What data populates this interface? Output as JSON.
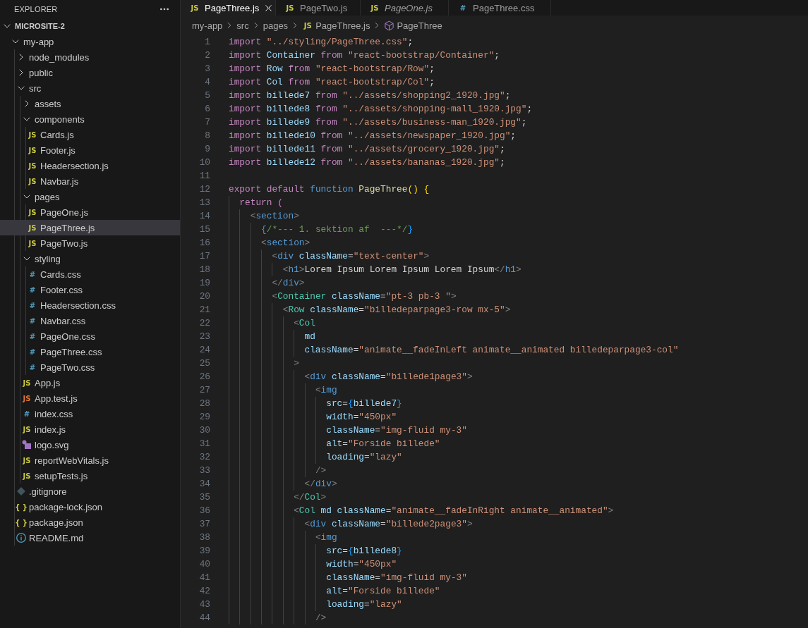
{
  "explorer": {
    "title": "EXPLORER",
    "tree": [
      {
        "label": "MICROSITE-2",
        "kind": "root",
        "expanded": true,
        "selected": false,
        "children": [
          {
            "label": "my-app",
            "kind": "folder",
            "expanded": true,
            "selected": false,
            "children": [
              {
                "label": "node_modules",
                "kind": "folder",
                "expanded": false,
                "selected": false
              },
              {
                "label": "public",
                "kind": "folder",
                "expanded": false,
                "selected": false
              },
              {
                "label": "src",
                "kind": "folder",
                "expanded": true,
                "selected": false,
                "children": [
                  {
                    "label": "assets",
                    "kind": "folder",
                    "expanded": false,
                    "selected": false
                  },
                  {
                    "label": "components",
                    "kind": "folder",
                    "expanded": true,
                    "selected": false,
                    "children": [
                      {
                        "label": "Cards.js",
                        "kind": "js",
                        "icon": "JS",
                        "selected": false
                      },
                      {
                        "label": "Footer.js",
                        "kind": "js",
                        "icon": "JS",
                        "selected": false
                      },
                      {
                        "label": "Headersection.js",
                        "kind": "js",
                        "icon": "JS",
                        "selected": false
                      },
                      {
                        "label": "Navbar.js",
                        "kind": "js",
                        "icon": "JS",
                        "selected": false
                      }
                    ]
                  },
                  {
                    "label": "pages",
                    "kind": "folder",
                    "expanded": true,
                    "selected": false,
                    "children": [
                      {
                        "label": "PageOne.js",
                        "kind": "js",
                        "icon": "JS",
                        "selected": false
                      },
                      {
                        "label": "PageThree.js",
                        "kind": "js",
                        "icon": "JS",
                        "selected": true
                      },
                      {
                        "label": "PageTwo.js",
                        "kind": "js",
                        "icon": "JS",
                        "selected": false
                      }
                    ]
                  },
                  {
                    "label": "styling",
                    "kind": "folder",
                    "expanded": true,
                    "selected": false,
                    "children": [
                      {
                        "label": "Cards.css",
                        "kind": "css",
                        "icon": "#",
                        "selected": false
                      },
                      {
                        "label": "Footer.css",
                        "kind": "css",
                        "icon": "#",
                        "selected": false
                      },
                      {
                        "label": "Headersection.css",
                        "kind": "css",
                        "icon": "#",
                        "selected": false
                      },
                      {
                        "label": "Navbar.css",
                        "kind": "css",
                        "icon": "#",
                        "selected": false
                      },
                      {
                        "label": "PageOne.css",
                        "kind": "css",
                        "icon": "#",
                        "selected": false
                      },
                      {
                        "label": "PageThree.css",
                        "kind": "css",
                        "icon": "#",
                        "selected": false
                      },
                      {
                        "label": "PageTwo.css",
                        "kind": "css",
                        "icon": "#",
                        "selected": false
                      }
                    ]
                  },
                  {
                    "label": "App.js",
                    "kind": "js",
                    "icon": "JS",
                    "selected": false
                  },
                  {
                    "label": "App.test.js",
                    "kind": "test",
                    "icon": "JS",
                    "selected": false
                  },
                  {
                    "label": "index.css",
                    "kind": "css",
                    "icon": "#",
                    "selected": false
                  },
                  {
                    "label": "index.js",
                    "kind": "js",
                    "icon": "JS",
                    "selected": false
                  },
                  {
                    "label": "logo.svg",
                    "kind": "svg",
                    "selected": false
                  },
                  {
                    "label": "reportWebVitals.js",
                    "kind": "js",
                    "icon": "JS",
                    "selected": false
                  },
                  {
                    "label": "setupTests.js",
                    "kind": "js",
                    "icon": "JS",
                    "selected": false
                  }
                ]
              },
              {
                "label": ".gitignore",
                "kind": "git",
                "selected": false
              },
              {
                "label": "package-lock.json",
                "kind": "json",
                "icon": "{ }",
                "selected": false
              },
              {
                "label": "package.json",
                "kind": "json",
                "icon": "{ }",
                "selected": false
              },
              {
                "label": "README.md",
                "kind": "info",
                "selected": false
              }
            ]
          }
        ]
      }
    ]
  },
  "tabs": [
    {
      "label": "PageThree.js",
      "kind": "js",
      "icon": "JS",
      "selected": true,
      "preview": false
    },
    {
      "label": "PageTwo.js",
      "kind": "js",
      "icon": "JS",
      "selected": false,
      "preview": false
    },
    {
      "label": "PageOne.js",
      "kind": "js",
      "icon": "JS",
      "selected": false,
      "preview": true
    },
    {
      "label": "PageThree.css",
      "kind": "css",
      "icon": "#",
      "selected": false,
      "preview": false
    }
  ],
  "breadcrumbs": [
    {
      "kind": "folder",
      "text": "my-app"
    },
    {
      "kind": "folder",
      "text": "src"
    },
    {
      "kind": "folder",
      "text": "pages"
    },
    {
      "kind": "file",
      "icon": "JS",
      "text": "PageThree.js"
    },
    {
      "kind": "symbol",
      "text": "PageThree"
    }
  ],
  "code": [
    {
      "number": "1",
      "tokens": [
        {
          "kind": "kw",
          "text": "import "
        },
        {
          "kind": "str",
          "text": "\"../styling/PageThree.css\""
        },
        {
          "kind": "plain",
          "text": ";"
        }
      ]
    },
    {
      "number": "2",
      "tokens": [
        {
          "kind": "kw",
          "text": "import "
        },
        {
          "kind": "var",
          "text": "Container "
        },
        {
          "kind": "kw",
          "text": "from "
        },
        {
          "kind": "str",
          "text": "\"react-bootstrap/Container\""
        },
        {
          "kind": "plain",
          "text": ";"
        }
      ]
    },
    {
      "number": "3",
      "tokens": [
        {
          "kind": "kw",
          "text": "import "
        },
        {
          "kind": "var",
          "text": "Row "
        },
        {
          "kind": "kw",
          "text": "from "
        },
        {
          "kind": "str",
          "text": "\"react-bootstrap/Row\""
        },
        {
          "kind": "plain",
          "text": ";"
        }
      ]
    },
    {
      "number": "4",
      "tokens": [
        {
          "kind": "kw",
          "text": "import "
        },
        {
          "kind": "var",
          "text": "Col "
        },
        {
          "kind": "kw",
          "text": "from "
        },
        {
          "kind": "str",
          "text": "\"react-bootstrap/Col\""
        },
        {
          "kind": "plain",
          "text": ";"
        }
      ]
    },
    {
      "number": "5",
      "tokens": [
        {
          "kind": "kw",
          "text": "import "
        },
        {
          "kind": "var",
          "text": "billede7 "
        },
        {
          "kind": "kw",
          "text": "from "
        },
        {
          "kind": "str",
          "text": "\"../assets/shopping2_1920.jpg\""
        },
        {
          "kind": "plain",
          "text": ";"
        }
      ]
    },
    {
      "number": "6",
      "tokens": [
        {
          "kind": "kw",
          "text": "import "
        },
        {
          "kind": "var",
          "text": "billede8 "
        },
        {
          "kind": "kw",
          "text": "from "
        },
        {
          "kind": "str",
          "text": "\"../assets/shopping-mall_1920.jpg\""
        },
        {
          "kind": "plain",
          "text": ";"
        }
      ]
    },
    {
      "number": "7",
      "tokens": [
        {
          "kind": "kw",
          "text": "import "
        },
        {
          "kind": "var",
          "text": "billede9 "
        },
        {
          "kind": "kw",
          "text": "from "
        },
        {
          "kind": "str",
          "text": "\"../assets/business-man_1920.jpg\""
        },
        {
          "kind": "plain",
          "text": ";"
        }
      ]
    },
    {
      "number": "8",
      "tokens": [
        {
          "kind": "kw",
          "text": "import "
        },
        {
          "kind": "var",
          "text": "billede10 "
        },
        {
          "kind": "kw",
          "text": "from "
        },
        {
          "kind": "str",
          "text": "\"../assets/newspaper_1920.jpg\""
        },
        {
          "kind": "plain",
          "text": ";"
        }
      ]
    },
    {
      "number": "9",
      "tokens": [
        {
          "kind": "kw",
          "text": "import "
        },
        {
          "kind": "var",
          "text": "billede11 "
        },
        {
          "kind": "kw",
          "text": "from "
        },
        {
          "kind": "str",
          "text": "\"../assets/grocery_1920.jpg\""
        },
        {
          "kind": "plain",
          "text": ";"
        }
      ]
    },
    {
      "number": "10",
      "tokens": [
        {
          "kind": "kw",
          "text": "import "
        },
        {
          "kind": "var",
          "text": "billede12 "
        },
        {
          "kind": "kw",
          "text": "from "
        },
        {
          "kind": "str",
          "text": "\"../assets/bananas_1920.jpg\""
        },
        {
          "kind": "plain",
          "text": ";"
        }
      ]
    },
    {
      "number": "11"
    },
    {
      "number": "12",
      "tokens": [
        {
          "kind": "kw",
          "text": "export default "
        },
        {
          "kind": "kw2",
          "text": "function "
        },
        {
          "kind": "fn",
          "text": "PageThree"
        },
        {
          "kind": "br1",
          "text": "() {"
        }
      ],
      "children": [
        {
          "number": "13",
          "tokens": [
            {
              "kind": "kw",
              "text": "return "
            },
            {
              "kind": "br2",
              "text": "("
            }
          ],
          "children": [
            {
              "number": "14",
              "tokens": [
                {
                  "kind": "lt",
                  "text": "<"
                },
                {
                  "kind": "tag",
                  "text": "section"
                },
                {
                  "kind": "lt",
                  "text": ">"
                }
              ],
              "children": [
                {
                  "number": "15",
                  "tokens": [
                    {
                      "kind": "br3",
                      "text": "{"
                    },
                    {
                      "kind": "cmt",
                      "text": "/*--- 1. sektion af  ---*/"
                    },
                    {
                      "kind": "br3",
                      "text": "}"
                    }
                  ]
                },
                {
                  "number": "16",
                  "tokens": [
                    {
                      "kind": "lt",
                      "text": "<"
                    },
                    {
                      "kind": "tag",
                      "text": "section"
                    },
                    {
                      "kind": "lt",
                      "text": ">"
                    }
                  ],
                  "children": [
                    {
                      "number": "17",
                      "tokens": [
                        {
                          "kind": "lt",
                          "text": "<"
                        },
                        {
                          "kind": "tag",
                          "text": "div"
                        },
                        {
                          "kind": "attr",
                          "text": " className"
                        },
                        {
                          "kind": "plain",
                          "text": "="
                        },
                        {
                          "kind": "str",
                          "text": "\"text-center\""
                        },
                        {
                          "kind": "lt",
                          "text": ">"
                        }
                      ],
                      "children": [
                        {
                          "number": "18",
                          "tokens": [
                            {
                              "kind": "lt",
                              "text": "<"
                            },
                            {
                              "kind": "tag",
                              "text": "h1"
                            },
                            {
                              "kind": "lt",
                              "text": ">"
                            },
                            {
                              "kind": "plain",
                              "text": "Lorem Ipsum Lorem Ipsum Lorem Ipsum"
                            },
                            {
                              "kind": "lt",
                              "text": "</"
                            },
                            {
                              "kind": "tag",
                              "text": "h1"
                            },
                            {
                              "kind": "lt",
                              "text": ">"
                            }
                          ]
                        }
                      ]
                    },
                    {
                      "number": "19",
                      "tokens": [
                        {
                          "kind": "lt",
                          "text": "</"
                        },
                        {
                          "kind": "tag",
                          "text": "div"
                        },
                        {
                          "kind": "lt",
                          "text": ">"
                        }
                      ]
                    },
                    {
                      "number": "20",
                      "tokens": [
                        {
                          "kind": "lt",
                          "text": "<"
                        },
                        {
                          "kind": "comp",
                          "text": "Container"
                        },
                        {
                          "kind": "attr",
                          "text": " className"
                        },
                        {
                          "kind": "plain",
                          "text": "="
                        },
                        {
                          "kind": "str",
                          "text": "\"pt-3 pb-3 \""
                        },
                        {
                          "kind": "lt",
                          "text": ">"
                        }
                      ],
                      "children": [
                        {
                          "number": "21",
                          "tokens": [
                            {
                              "kind": "lt",
                              "text": "<"
                            },
                            {
                              "kind": "comp",
                              "text": "Row"
                            },
                            {
                              "kind": "attr",
                              "text": " className"
                            },
                            {
                              "kind": "plain",
                              "text": "="
                            },
                            {
                              "kind": "str",
                              "text": "\"billedeparpage3-row mx-5\""
                            },
                            {
                              "kind": "lt",
                              "text": ">"
                            }
                          ],
                          "children": [
                            {
                              "number": "22",
                              "tokens": [
                                {
                                  "kind": "lt",
                                  "text": "<"
                                },
                                {
                                  "kind": "comp",
                                  "text": "Col"
                                }
                              ],
                              "children": [
                                {
                                  "number": "23",
                                  "tokens": [
                                    {
                                      "kind": "attr",
                                      "text": "md"
                                    }
                                  ]
                                },
                                {
                                  "number": "24",
                                  "tokens": [
                                    {
                                      "kind": "attr",
                                      "text": "className"
                                    },
                                    {
                                      "kind": "plain",
                                      "text": "="
                                    },
                                    {
                                      "kind": "str",
                                      "text": "\"animate__fadeInLeft animate__animated billedeparpage3-col\""
                                    }
                                  ]
                                }
                              ]
                            },
                            {
                              "number": "25",
                              "tokens": [
                                {
                                  "kind": "lt",
                                  "text": ">"
                                }
                              ],
                              "children": [
                                {
                                  "number": "26",
                                  "tokens": [
                                    {
                                      "kind": "lt",
                                      "text": "<"
                                    },
                                    {
                                      "kind": "tag",
                                      "text": "div"
                                    },
                                    {
                                      "kind": "attr",
                                      "text": " className"
                                    },
                                    {
                                      "kind": "plain",
                                      "text": "="
                                    },
                                    {
                                      "kind": "str",
                                      "text": "\"billede1page3\""
                                    },
                                    {
                                      "kind": "lt",
                                      "text": ">"
                                    }
                                  ],
                                  "children": [
                                    {
                                      "number": "27",
                                      "tokens": [
                                        {
                                          "kind": "lt",
                                          "text": "<"
                                        },
                                        {
                                          "kind": "tag",
                                          "text": "img"
                                        }
                                      ],
                                      "children": [
                                        {
                                          "number": "28",
                                          "tokens": [
                                            {
                                              "kind": "attr",
                                              "text": "src"
                                            },
                                            {
                                              "kind": "plain",
                                              "text": "="
                                            },
                                            {
                                              "kind": "br3",
                                              "text": "{"
                                            },
                                            {
                                              "kind": "var",
                                              "text": "billede7"
                                            },
                                            {
                                              "kind": "br3",
                                              "text": "}"
                                            }
                                          ]
                                        },
                                        {
                                          "number": "29",
                                          "tokens": [
                                            {
                                              "kind": "attr",
                                              "text": "width"
                                            },
                                            {
                                              "kind": "plain",
                                              "text": "="
                                            },
                                            {
                                              "kind": "str",
                                              "text": "\"450px\""
                                            }
                                          ]
                                        },
                                        {
                                          "number": "30",
                                          "tokens": [
                                            {
                                              "kind": "attr",
                                              "text": "className"
                                            },
                                            {
                                              "kind": "plain",
                                              "text": "="
                                            },
                                            {
                                              "kind": "str",
                                              "text": "\"img-fluid my-3\""
                                            }
                                          ]
                                        },
                                        {
                                          "number": "31",
                                          "tokens": [
                                            {
                                              "kind": "attr",
                                              "text": "alt"
                                            },
                                            {
                                              "kind": "plain",
                                              "text": "="
                                            },
                                            {
                                              "kind": "str",
                                              "text": "\"Forside billede\""
                                            }
                                          ]
                                        },
                                        {
                                          "number": "32",
                                          "tokens": [
                                            {
                                              "kind": "attr",
                                              "text": "loading"
                                            },
                                            {
                                              "kind": "plain",
                                              "text": "="
                                            },
                                            {
                                              "kind": "str",
                                              "text": "\"lazy\""
                                            }
                                          ]
                                        }
                                      ]
                                    },
                                    {
                                      "number": "33",
                                      "tokens": [
                                        {
                                          "kind": "lt",
                                          "text": "/>"
                                        }
                                      ]
                                    }
                                  ]
                                },
                                {
                                  "number": "34",
                                  "tokens": [
                                    {
                                      "kind": "lt",
                                      "text": "</"
                                    },
                                    {
                                      "kind": "tag",
                                      "text": "div"
                                    },
                                    {
                                      "kind": "lt",
                                      "text": ">"
                                    }
                                  ]
                                }
                              ]
                            },
                            {
                              "number": "35",
                              "tokens": [
                                {
                                  "kind": "lt",
                                  "text": "</"
                                },
                                {
                                  "kind": "comp",
                                  "text": "Col"
                                },
                                {
                                  "kind": "lt",
                                  "text": ">"
                                }
                              ]
                            },
                            {
                              "number": "36",
                              "tokens": [
                                {
                                  "kind": "lt",
                                  "text": "<"
                                },
                                {
                                  "kind": "comp",
                                  "text": "Col"
                                },
                                {
                                  "kind": "attr",
                                  "text": " md className"
                                },
                                {
                                  "kind": "plain",
                                  "text": "="
                                },
                                {
                                  "kind": "str",
                                  "text": "\"animate__fadeInRight animate__animated\""
                                },
                                {
                                  "kind": "lt",
                                  "text": ">"
                                }
                              ],
                              "children": [
                                {
                                  "number": "37",
                                  "tokens": [
                                    {
                                      "kind": "lt",
                                      "text": "<"
                                    },
                                    {
                                      "kind": "tag",
                                      "text": "div"
                                    },
                                    {
                                      "kind": "attr",
                                      "text": " className"
                                    },
                                    {
                                      "kind": "plain",
                                      "text": "="
                                    },
                                    {
                                      "kind": "str",
                                      "text": "\"billede2page3\""
                                    },
                                    {
                                      "kind": "lt",
                                      "text": ">"
                                    }
                                  ],
                                  "children": [
                                    {
                                      "number": "38",
                                      "tokens": [
                                        {
                                          "kind": "lt",
                                          "text": "<"
                                        },
                                        {
                                          "kind": "tag",
                                          "text": "img"
                                        }
                                      ],
                                      "children": [
                                        {
                                          "number": "39",
                                          "tokens": [
                                            {
                                              "kind": "attr",
                                              "text": "src"
                                            },
                                            {
                                              "kind": "plain",
                                              "text": "="
                                            },
                                            {
                                              "kind": "br3",
                                              "text": "{"
                                            },
                                            {
                                              "kind": "var",
                                              "text": "billede8"
                                            },
                                            {
                                              "kind": "br3",
                                              "text": "}"
                                            }
                                          ]
                                        },
                                        {
                                          "number": "40",
                                          "tokens": [
                                            {
                                              "kind": "attr",
                                              "text": "width"
                                            },
                                            {
                                              "kind": "plain",
                                              "text": "="
                                            },
                                            {
                                              "kind": "str",
                                              "text": "\"450px\""
                                            }
                                          ]
                                        },
                                        {
                                          "number": "41",
                                          "tokens": [
                                            {
                                              "kind": "attr",
                                              "text": "className"
                                            },
                                            {
                                              "kind": "plain",
                                              "text": "="
                                            },
                                            {
                                              "kind": "str",
                                              "text": "\"img-fluid my-3\""
                                            }
                                          ]
                                        },
                                        {
                                          "number": "42",
                                          "tokens": [
                                            {
                                              "kind": "attr",
                                              "text": "alt"
                                            },
                                            {
                                              "kind": "plain",
                                              "text": "="
                                            },
                                            {
                                              "kind": "str",
                                              "text": "\"Forside billede\""
                                            }
                                          ]
                                        },
                                        {
                                          "number": "43",
                                          "tokens": [
                                            {
                                              "kind": "attr",
                                              "text": "loading"
                                            },
                                            {
                                              "kind": "plain",
                                              "text": "="
                                            },
                                            {
                                              "kind": "str",
                                              "text": "\"lazy\""
                                            }
                                          ]
                                        }
                                      ]
                                    },
                                    {
                                      "number": "44",
                                      "tokens": [
                                        {
                                          "kind": "lt",
                                          "text": "/>"
                                        }
                                      ]
                                    }
                                  ]
                                }
                              ]
                            }
                          ]
                        }
                      ]
                    }
                  ]
                }
              ]
            }
          ]
        }
      ]
    }
  ]
}
